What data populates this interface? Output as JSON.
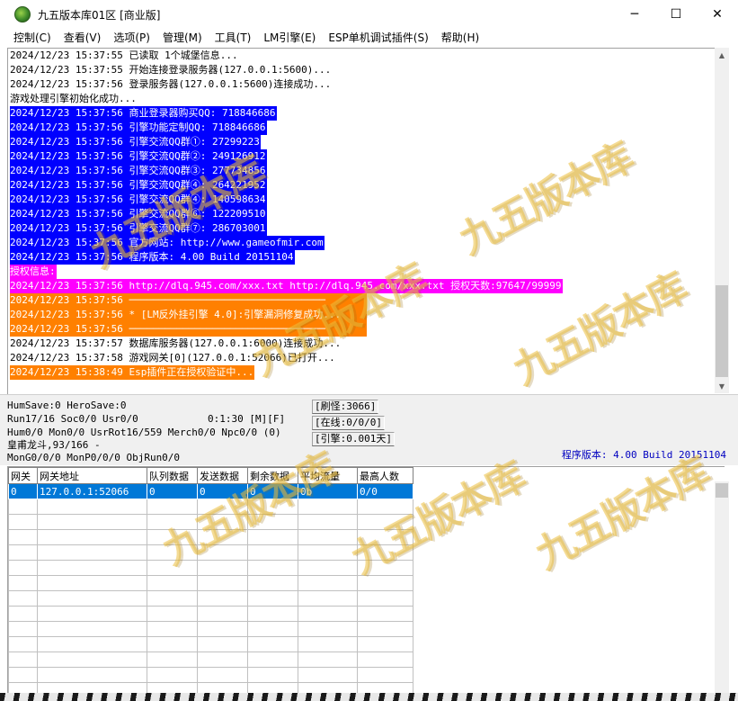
{
  "window": {
    "title": "九五版本库01区 [商业版]",
    "minimize": "─",
    "maximize": "☐",
    "close": "✕"
  },
  "menu": [
    "控制(C)",
    "查看(V)",
    "选项(P)",
    "管理(M)",
    "工具(T)",
    "LM引擎(E)",
    "ESP单机调试插件(S)",
    "帮助(H)"
  ],
  "log": [
    {
      "text": "2024/12/23 15:37:55 已读取 1个城堡信息...",
      "style": "plain"
    },
    {
      "text": "2024/12/23 15:37:55 开始连接登录服务器(127.0.0.1:5600)...",
      "style": "plain"
    },
    {
      "text": "2024/12/23 15:37:56 登录服务器(127.0.0.1:5600)连接成功...",
      "style": "plain"
    },
    {
      "text": "游戏处理引擎初始化成功...",
      "style": "plain"
    },
    {
      "text": "2024/12/23 15:37:56 商业登录器购买QQ: 718846686",
      "style": "blue"
    },
    {
      "text": "2024/12/23 15:37:56 引擎功能定制QQ: 718846686",
      "style": "blue"
    },
    {
      "text": "2024/12/23 15:37:56 引擎交流QQ群①: 27299223",
      "style": "blue"
    },
    {
      "text": "2024/12/23 15:37:56 引擎交流QQ群②: 249126912",
      "style": "blue"
    },
    {
      "text": "2024/12/23 15:37:56 引擎交流QQ群③: 277734856",
      "style": "blue"
    },
    {
      "text": "2024/12/23 15:37:56 引擎交流QQ群④: 264221952",
      "style": "blue"
    },
    {
      "text": "2024/12/23 15:37:56 引擎交流QQ群④: 140598634",
      "style": "blue"
    },
    {
      "text": "2024/12/23 15:37:56 引擎交流QQ群⑥: 122209510",
      "style": "blue"
    },
    {
      "text": "2024/12/23 15:37:56 引擎交流QQ群⑦: 286703001",
      "style": "blue"
    },
    {
      "text": "2024/12/23 15:37:56 官方网站: http://www.gameofmir.com",
      "style": "blue"
    },
    {
      "text": "2024/12/23 15:37:56 程序版本: 4.00 Build 20151104",
      "style": "blue"
    },
    {
      "text": "授权信息:",
      "style": "magenta"
    },
    {
      "text": "2024/12/23 15:37:56 http://dlq.945.com/xxx.txt http://dlq.945.com/xxx.txt 授权天数:97647/99999",
      "style": "magenta"
    },
    {
      "text": "2024/12/23 15:37:56 ─────────────────────────────────",
      "style": "orange-bar"
    },
    {
      "text": "2024/12/23 15:37:56 * [LM反外挂引擎 4.0]:引擎漏洞修复成功...",
      "style": "orange-bar"
    },
    {
      "text": "2024/12/23 15:37:56 ─────────────────────────────────",
      "style": "orange-bar"
    },
    {
      "text": "2024/12/23 15:37:57 数据库服务器(127.0.0.1:6000)连接成功...",
      "style": "plain"
    },
    {
      "text": "2024/12/23 15:37:58 游戏网关[0](127.0.0.1:52066)已打开...",
      "style": "plain"
    },
    {
      "text": "2024/12/23 15:38:49 Esp插件正在授权验证中...",
      "style": "orange"
    }
  ],
  "status": {
    "line1": "HumSave:0 HeroSave:0",
    "line2": "Run17/16 Soc0/0 Usr0/0",
    "uptime": "0:1:30 [M][F]",
    "line3": "Hum0/0 Mon0/0 UsrRot16/559 Merch0/0 Npc0/0 (0)",
    "line4": "皇甫龙斗,93/166 -",
    "line5": "MonG0/0/0 MonP0/0/0 ObjRun0/0",
    "refresh": "[刷怪:3066]",
    "online": "[在线:0/0/0]",
    "engine": "[引擎:0.001天]",
    "version": "程序版本: 4.00 Build 20151104"
  },
  "grid": {
    "columns": [
      "网关",
      "网关地址",
      "队列数据",
      "发送数据",
      "剩余数据",
      "平均流量",
      "最高人数"
    ],
    "rows": [
      [
        "0",
        "127.0.0.1:52066",
        "0",
        "0",
        "0",
        "0b",
        "0/0"
      ]
    ]
  },
  "watermark_text": "九五版本库",
  "colors": {
    "blue_highlight": "#0000ff",
    "magenta_highlight": "#ff00ff",
    "orange_highlight": "#ff8000",
    "selection": "#0078d7"
  }
}
